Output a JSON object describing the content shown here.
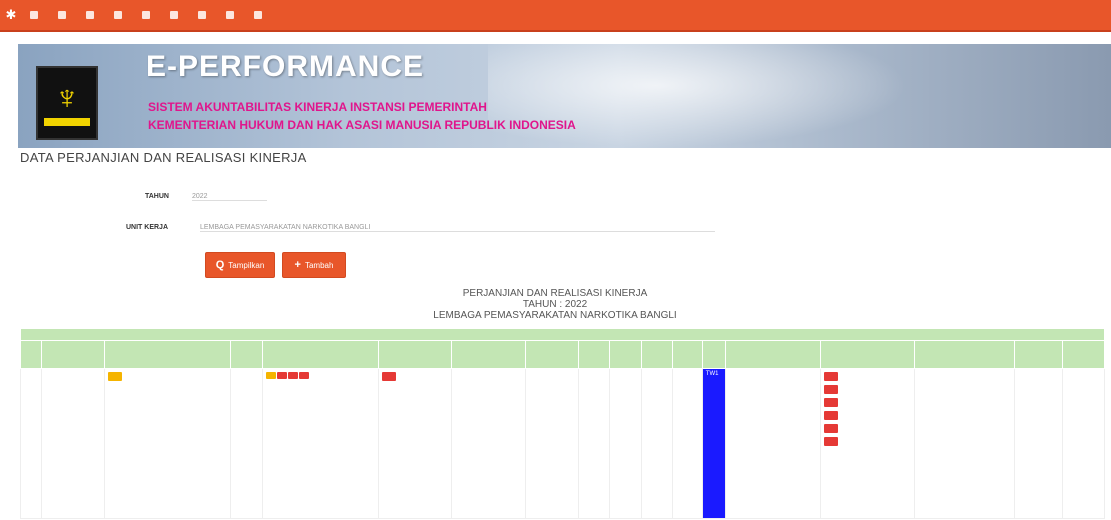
{
  "banner": {
    "title": "E-PERFORMANCE",
    "subtitle1": "SISTEM AKUNTABILITAS KINERJA INSTANSI PEMERINTAH",
    "subtitle2": "KEMENTERIAN HUKUM DAN HAK ASASI MANUSIA REPUBLIK INDONESIA"
  },
  "page": {
    "title": "DATA PERJANJIAN DAN REALISASI KINERJA",
    "tahun_label": "TAHUN",
    "tahun_value": "2022",
    "unit_label": "UNIT KERJA",
    "unit_value": "LEMBAGA PEMASYARAKATAN NARKOTIKA BANGLI",
    "search_label": "Tampilkan",
    "add_label": "Tambah"
  },
  "report": {
    "line1": "PERJANJIAN DAN REALISASI KINERJA",
    "line2": "TAHUN : 2022",
    "line3": "LEMBAGA PEMASYARAKATAN NARKOTIKA BANGLI"
  },
  "table": {
    "row": {
      "tw": "TW1"
    }
  },
  "colors": {
    "nav": "#e8562a",
    "accent": "#e53935",
    "header": "#c3e6b4",
    "highlight": "#1a1aff"
  }
}
